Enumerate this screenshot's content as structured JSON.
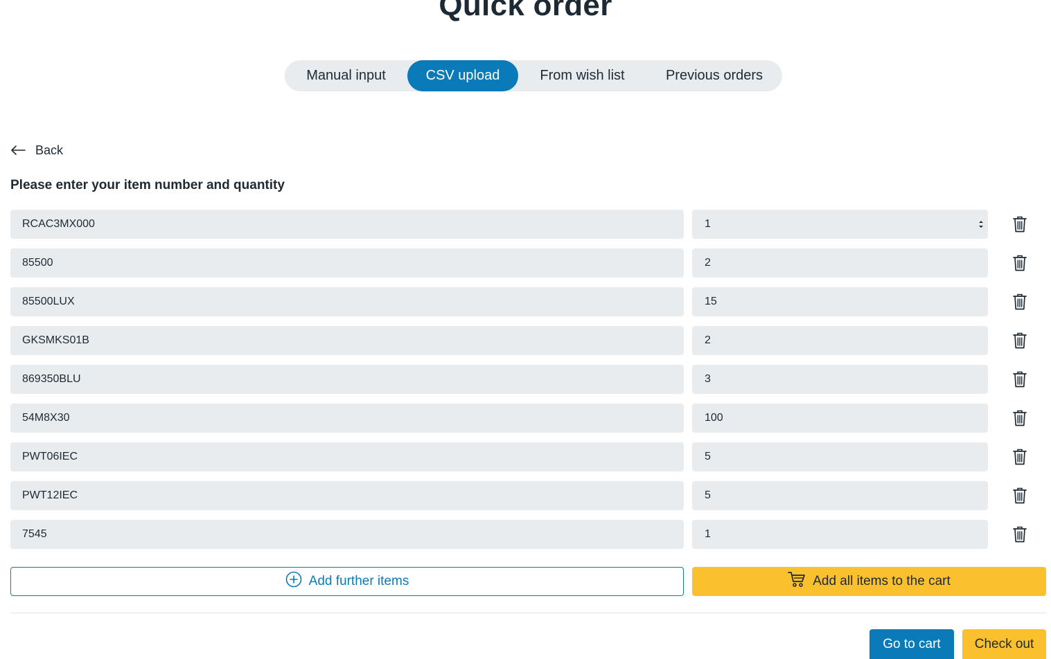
{
  "page": {
    "title": "Quick order"
  },
  "tabs": [
    {
      "label": "Manual input",
      "active": false
    },
    {
      "label": "CSV upload",
      "active": true
    },
    {
      "label": "From wish list",
      "active": false
    },
    {
      "label": "Previous orders",
      "active": false
    }
  ],
  "back": {
    "label": "Back",
    "icon": "arrow-left-icon"
  },
  "form": {
    "instruction": "Please enter your item number and quantity",
    "rows": [
      {
        "item": "RCAC3MX000",
        "qty": "1"
      },
      {
        "item": "85500",
        "qty": "2"
      },
      {
        "item": "85500LUX",
        "qty": "15"
      },
      {
        "item": "GKSMKS01B",
        "qty": "2"
      },
      {
        "item": "869350BLU",
        "qty": "3"
      },
      {
        "item": "54M8X30",
        "qty": "100"
      },
      {
        "item": "PWT06IEC",
        "qty": "5"
      },
      {
        "item": "PWT12IEC",
        "qty": "5"
      },
      {
        "item": "7545",
        "qty": "1"
      }
    ],
    "delete_icon": "trash-icon"
  },
  "actions": {
    "add_further_label": "Add further items",
    "add_further_icon": "plus-circle-icon",
    "add_all_label": "Add all items to the cart",
    "add_all_icon": "cart-icon",
    "go_to_cart_label": "Go to cart",
    "check_out_label": "Check out"
  },
  "colors": {
    "primary": "#0a7bb8",
    "accent": "#fbc02d",
    "field_bg": "#e8ecef",
    "text": "#1e2a33"
  }
}
